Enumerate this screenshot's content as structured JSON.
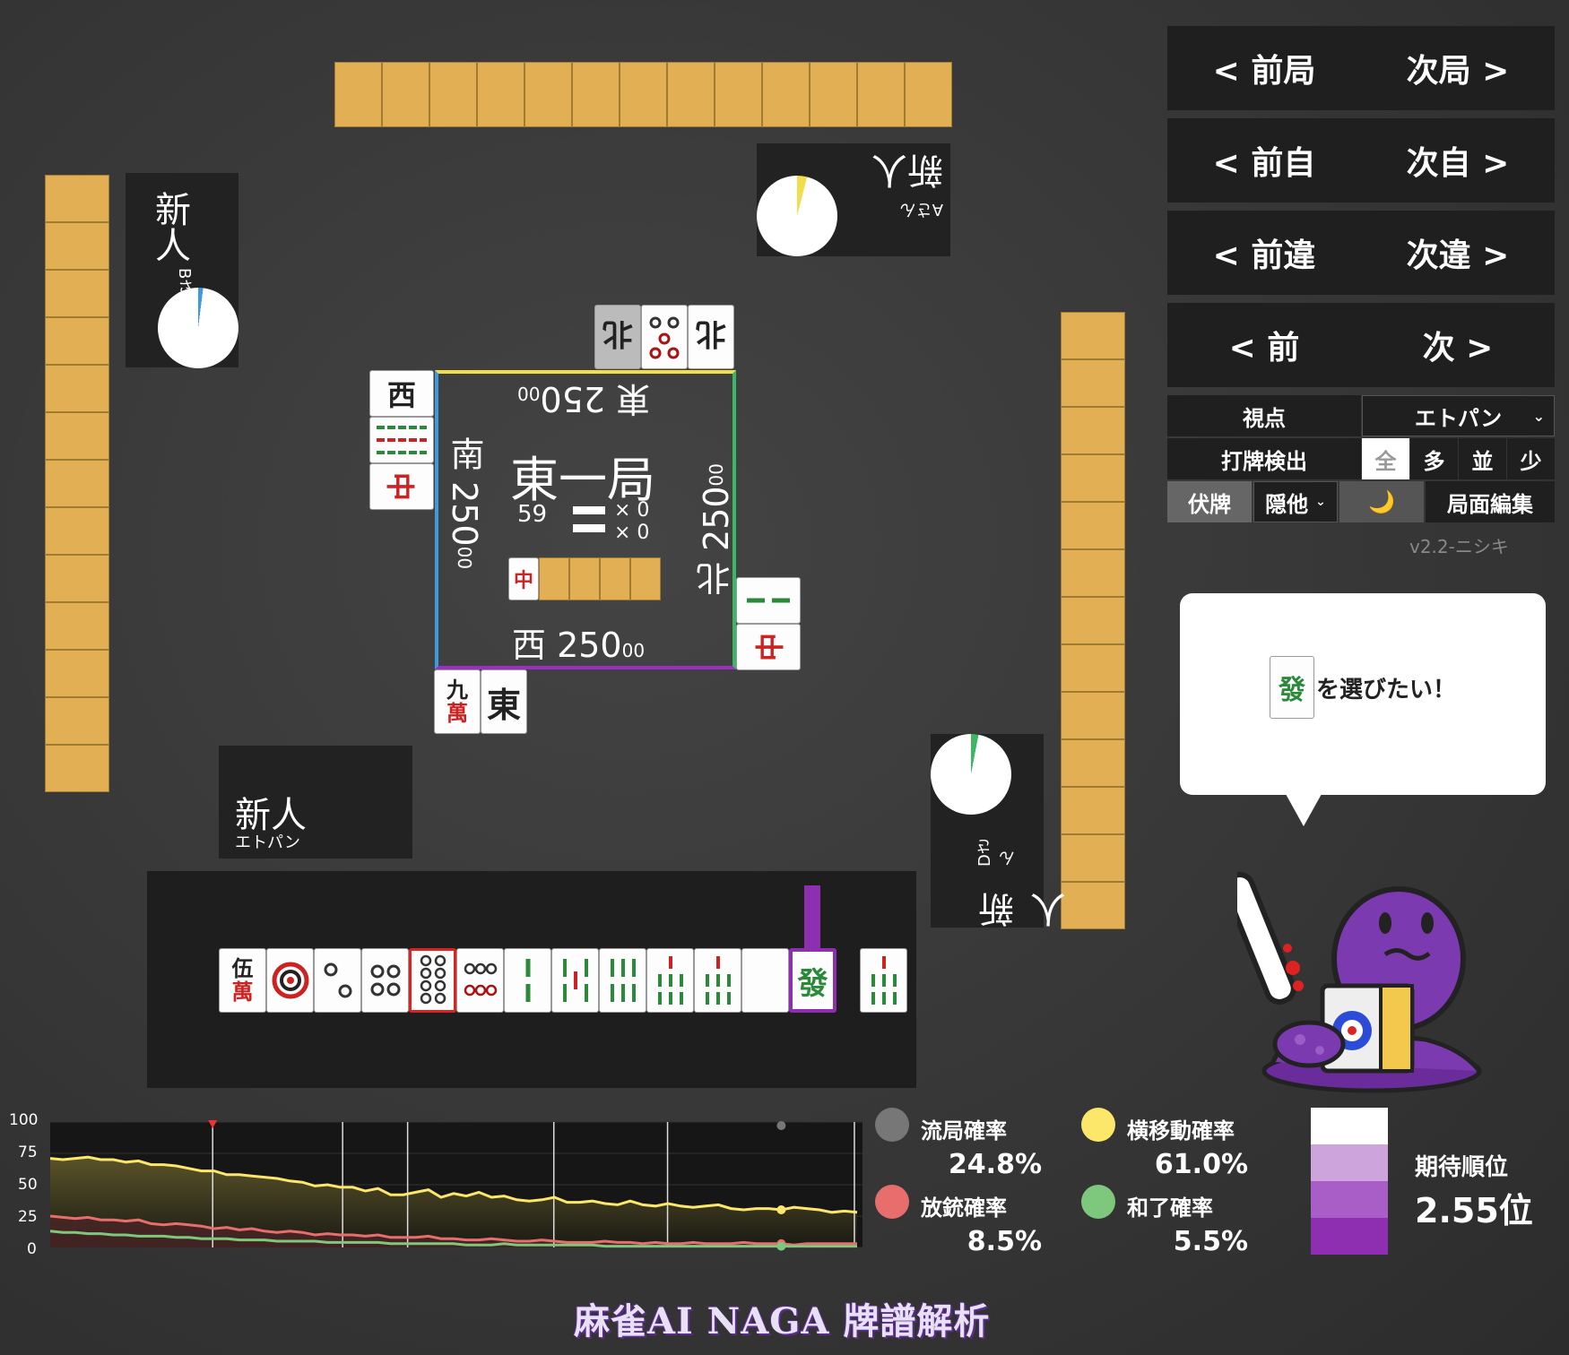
{
  "nav": {
    "prev_round": "< 前局",
    "next_round": "次局 >",
    "prev_self": "< 前自",
    "next_self": "次自 >",
    "prev_diff": "< 前違",
    "next_diff": "次違 >",
    "prev": "< 前",
    "next": "次 >"
  },
  "controls": {
    "viewpoint_label": "視点",
    "viewpoint_value": "エトパン",
    "discard_detect_label": "打牌検出",
    "detect_options": [
      "全",
      "多",
      "並",
      "少"
    ],
    "hidden_tiles": "伏牌",
    "hide_others": "隠他",
    "moon": "🌙",
    "edit_board": "局面編集",
    "version": "v2.2-ニシキ"
  },
  "players": {
    "top": {
      "name": "新人",
      "sub": "Aさん"
    },
    "left": {
      "name": "新人",
      "sub": "Bさん"
    },
    "right": {
      "name": "新人",
      "sub": "Dさん"
    },
    "bottom": {
      "name": "新人",
      "sub": "エトパン"
    }
  },
  "center": {
    "round": "東一局",
    "tiles_left": "59",
    "honba": "× 0",
    "riichi": "× 0",
    "east_score": "東 250",
    "south_score": "南 250",
    "west_score": "西 250",
    "north_score": "北 250",
    "small_zero": "00",
    "dora_indicator": "中"
  },
  "bubble": {
    "tile": "發",
    "text": "を選びたい！"
  },
  "hand": [
    "伍萬",
    "1p",
    "2p",
    "4p",
    "8p",
    "6p",
    "2s",
    "5s",
    "6s",
    "7s",
    "7s",
    "",
    "發",
    "7s"
  ],
  "stats": {
    "ryukyoku_label": "流局確率",
    "ryukyoku_value": "24.8%",
    "yokoido_label": "横移動確率",
    "yokoido_value": "61.0%",
    "houju_label": "放銃確率",
    "houju_value": "8.5%",
    "agari_label": "和了確率",
    "agari_value": "5.5%",
    "expected_label": "期待順位",
    "expected_value": "2.55位"
  },
  "graph": {
    "y_ticks": [
      "100",
      "75",
      "50",
      "25",
      "0"
    ],
    "yellow": [
      71,
      70,
      71,
      72,
      70,
      70,
      68,
      69,
      66,
      66,
      65,
      63,
      61,
      61,
      58,
      58,
      57,
      56,
      55,
      53,
      52,
      49,
      50,
      48,
      48,
      45,
      47,
      42,
      42,
      44,
      46,
      40,
      43,
      41,
      44,
      40,
      41,
      38,
      37,
      38,
      40,
      36,
      36,
      37,
      35,
      34,
      37,
      34,
      33,
      35,
      33,
      32,
      33,
      34,
      31,
      30,
      31,
      31,
      30,
      32,
      31,
      30,
      28,
      29,
      28
    ],
    "red": [
      25,
      24,
      23,
      24,
      22,
      22,
      21,
      22,
      19,
      18,
      19,
      18,
      17,
      15,
      16,
      14,
      15,
      13,
      12,
      13,
      12,
      10,
      11,
      10,
      10,
      9,
      10,
      8,
      8,
      8,
      9,
      7,
      7,
      6,
      6,
      7,
      6,
      5,
      5,
      6,
      5,
      4,
      4,
      4,
      5,
      4,
      4,
      3,
      4,
      3,
      3,
      4,
      3,
      3,
      3,
      4,
      3,
      3,
      3,
      2,
      3,
      3,
      3,
      3,
      3
    ],
    "green": [
      13,
      12,
      12,
      11,
      11,
      10,
      10,
      9,
      9,
      9,
      8,
      8,
      7,
      7,
      7,
      6,
      6,
      6,
      5,
      5,
      5,
      5,
      4,
      4,
      4,
      4,
      4,
      3,
      3,
      3,
      3,
      3,
      3,
      2,
      2,
      2,
      3,
      2,
      2,
      2,
      2,
      2,
      2,
      2,
      1,
      1,
      1,
      1,
      1,
      1,
      1,
      1,
      1,
      1,
      1,
      1,
      1,
      1,
      1,
      1,
      1,
      1,
      1,
      1,
      1
    ]
  },
  "brand": "麻雀AI NAGA 牌譜解析",
  "colors": {
    "yellow": "#fde76a",
    "red": "#e86e6e",
    "green": "#7dc87d",
    "grey": "#777",
    "purple": "#8e2fb2"
  }
}
